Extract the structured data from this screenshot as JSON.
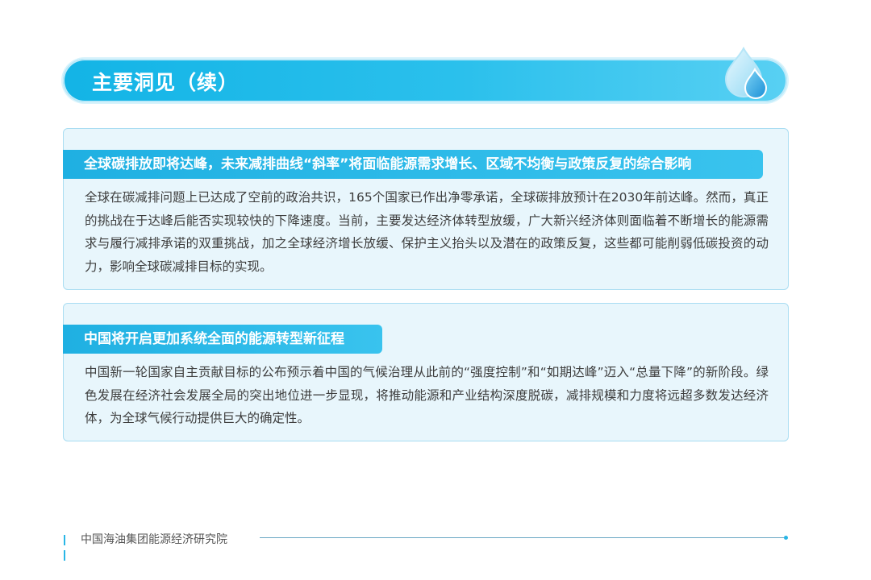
{
  "header": {
    "title": "主要洞见（续）",
    "icon": "water-drop-icon"
  },
  "sections": [
    {
      "heading": "全球碳排放即将达峰，未来减排曲线“斜率”将面临能源需求增长、区域不均衡与政策反复的综合影响",
      "body": "全球在碳减排问题上已达成了空前的政治共识，165个国家已作出净零承诺，全球碳排放预计在2030年前达峰。然而，真正的挑战在于达峰后能否实现较快的下降速度。当前，主要发达经济体转型放缓，广大新兴经济体则面临着不断增长的能源需求与履行减排承诺的双重挑战，加之全球经济增长放缓、保护主义抬头以及潜在的政策反复，这些都可能削弱低碳投资的动力，影响全球碳减排目标的实现。"
    },
    {
      "heading": "中国将开启更加系统全面的能源转型新征程",
      "body": "中国新一轮国家自主贡献目标的公布预示着中国的气候治理从此前的“强度控制”和“如期达峰”迈入“总量下降”的新阶段。绿色发展在经济社会发展全局的突出地位进一步显现，将推动能源和产业结构深度脱碳，减排规模和力度将远超多数发达经济体，为全球气候行动提供巨大的确定性。"
    }
  ],
  "footer": {
    "organization": "中国海油集团能源经济研究院"
  },
  "colors": {
    "accent": "#1fb0e2",
    "card_background": "#e8f6fc",
    "card_border": "#a9ddf2"
  }
}
